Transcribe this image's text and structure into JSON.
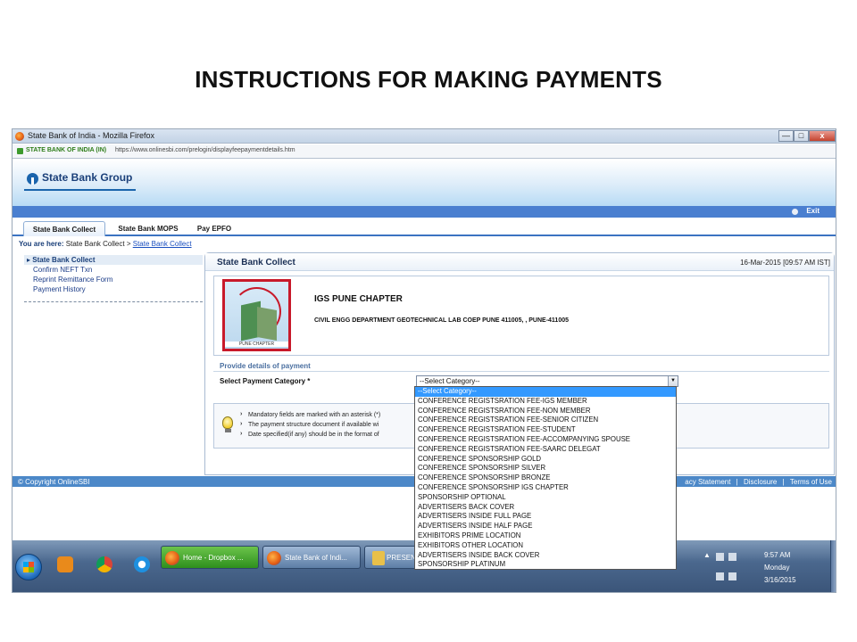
{
  "slide": {
    "title": "INSTRUCTIONS FOR MAKING PAYMENTS"
  },
  "browser": {
    "window_title": "State Bank of India - Mozilla Firefox",
    "window_buttons": {
      "minimize": "—",
      "maximize": "□",
      "close": "x"
    },
    "site_identity": "STATE BANK OF INDIA (IN)",
    "url": "https://www.onlinesbi.com/prelogin/displayfeepaymentdetails.htm"
  },
  "site": {
    "brand": "State Bank Group",
    "exit_label": "Exit",
    "tabs": [
      {
        "label": "State Bank Collect",
        "active": true
      },
      {
        "label": "State Bank MOPS",
        "active": false
      },
      {
        "label": "Pay EPFO",
        "active": false
      }
    ],
    "breadcrumb": {
      "prefix": "You are here:",
      "current": "State Bank Collect >",
      "link": "State Bank Collect"
    }
  },
  "leftnav": {
    "heading": "State Bank Collect",
    "items": [
      "Confirm NEFT Txn",
      "Reprint Remittance Form",
      "Payment History"
    ]
  },
  "panel": {
    "title": "State Bank Collect",
    "datetime": "16-Mar-2015 [09:57 AM IST]",
    "crest_label": "PUNE CHAPTER",
    "org_name": "IGS PUNE CHAPTER",
    "org_address": "CIVIL ENGG DEPARTMENT GEOTECHNICAL LAB COEP PUNE 411005, , PUNE-411005",
    "section_title": "Provide details of payment",
    "category_label": "Select Payment Category *",
    "category_selected": "--Select Category--",
    "notes": [
      "Mandatory fields are marked with an asterisk (*)",
      "The payment structure document if available wi",
      "Date specified(if any) should be in the format of"
    ]
  },
  "dropdown": {
    "options": [
      "--Select Category--",
      "CONFERENCE REGISTSRATION FEE-IGS MEMBER",
      "CONFERENCE REGISTSRATION FEE-NON MEMBER",
      "CONFERENCE REGISTSRATION FEE-SENIOR CITIZEN",
      "CONFERENCE REGISTSRATION FEE-STUDENT",
      "CONFERENCE REGISTSRATION FEE-ACCOMPANYING SPOUSE",
      "CONFERENCE REGISTSRATION FEE-SAARC DELEGAT",
      "CONFERENCE SPONSORSHIP GOLD",
      "CONFERENCE SPONSORSHIP SILVER",
      "CONFERENCE SPONSORSHIP BRONZE",
      "CONFERENCE SPONSORSHIP IGS CHAPTER",
      "SPONSORSHIP OPTIONAL",
      "ADVERTISERS BACK COVER",
      "ADVERTISERS INSIDE FULL PAGE",
      "ADVERTISERS INSIDE HALF PAGE",
      "EXHIBITORS PRIME LOCATION",
      "EXHIBITORS OTHER LOCATION",
      "ADVERTISERS INSIDE BACK COVER",
      "SPONSORSHIP PLATINUM"
    ]
  },
  "footer": {
    "copyright": "© Copyright OnlineSBI",
    "links": [
      "acy Statement",
      "|",
      "Disclosure",
      "|",
      "Terms of Use"
    ]
  },
  "taskbar": {
    "tasks": [
      "Home - Dropbox ...",
      "State Bank of Indi...",
      "PRESENTA"
    ],
    "clock": {
      "time": "9:57 AM",
      "day": "Monday",
      "date": "3/16/2015"
    }
  },
  "colors": {
    "header_blue": "#4a7fd0",
    "footer_blue": "#4c88c8",
    "selection": "#3399ff",
    "crest_border": "#c8192a"
  }
}
